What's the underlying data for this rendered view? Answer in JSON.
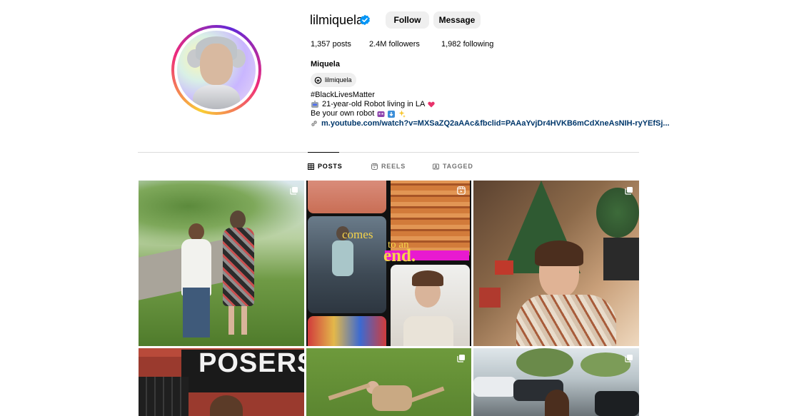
{
  "profile": {
    "username": "lilmiquela",
    "follow_label": "Follow",
    "message_label": "Message",
    "stats": {
      "posts": "1,357 posts",
      "followers": "2.4M followers",
      "following": "1,982 following"
    },
    "display_name": "Miquela",
    "threads_handle": "lilmiquela",
    "bio": {
      "line1": "#BlackLivesMatter",
      "line2": "21-year-old Robot living in LA",
      "line3": "Be your own robot"
    },
    "link": "m.youtube.com/watch?v=MXSaZQ2aAAc&fbclid=PAAaYvjDr4HVKB6mCdXneAsNIH-ryYEfSj..."
  },
  "tabs": [
    {
      "label": "POSTS",
      "active": true,
      "icon": "grid-icon"
    },
    {
      "label": "REELS",
      "active": false,
      "icon": "reels-icon"
    },
    {
      "label": "TAGGED",
      "active": false,
      "icon": "tagged-icon"
    }
  ],
  "collage": {
    "text1": "comes",
    "text2": "to an",
    "text3": "end."
  },
  "posters_sign": "POSERS",
  "colors": {
    "accent_link": "#00376b",
    "verified": "#0095f6",
    "button_bg": "#efefef"
  }
}
